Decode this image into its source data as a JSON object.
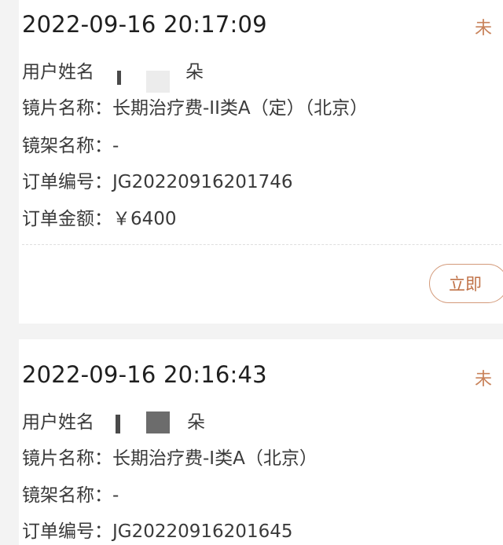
{
  "orders": [
    {
      "datetime": "2022-09-16 20:17:09",
      "status": "未",
      "rows": {
        "user_name": {
          "label": "用户姓名",
          "value": "朵"
        },
        "lens_name": {
          "label": "镜片名称：",
          "value": "长期治疗费-II类A（定）（北京）"
        },
        "frame_name": {
          "label": "镜架名称：",
          "value": "-"
        },
        "order_no": {
          "label": "订单编号：",
          "value": "JG20220916201746"
        },
        "order_amount": {
          "label": "订单金额：",
          "value": "￥6400"
        }
      },
      "action_label": "立即"
    },
    {
      "datetime": "2022-09-16 20:16:43",
      "status": "未",
      "rows": {
        "user_name": {
          "label": "用户姓名",
          "value": "朵"
        },
        "lens_name": {
          "label": "镜片名称：",
          "value": "长期治疗费-I类A（北京）"
        },
        "frame_name": {
          "label": "镜架名称：",
          "value": "-"
        },
        "order_no": {
          "label": "订单编号：",
          "value": "JG20220916201645"
        }
      }
    }
  ],
  "colors": {
    "accent": "#c07248",
    "status": "#c8825a",
    "background": "#f3f3f3",
    "card": "#ffffff"
  }
}
